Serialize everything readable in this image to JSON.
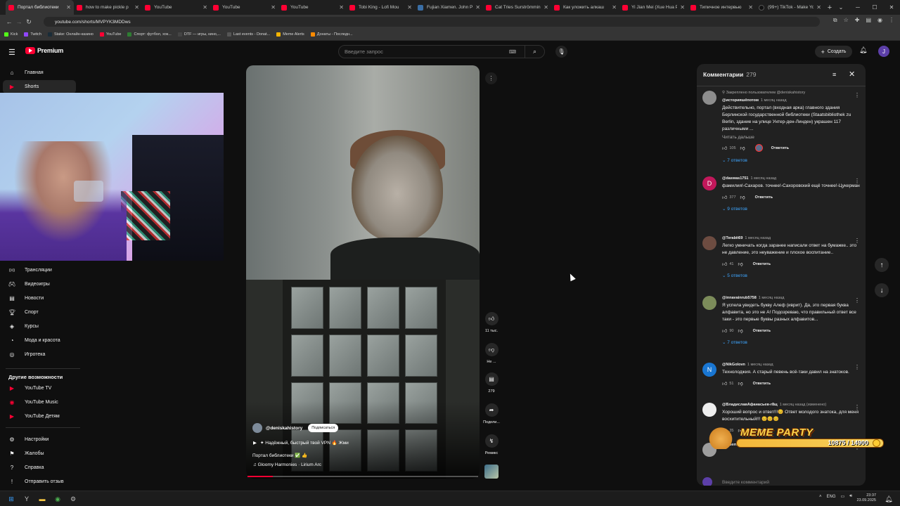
{
  "browser": {
    "tabs": [
      {
        "title": "Портал библиотеки",
        "icon": "youtube",
        "active": true
      },
      {
        "title": "how to make pickle p",
        "icon": "youtube"
      },
      {
        "title": "YouTube",
        "icon": "youtube"
      },
      {
        "title": "YouTube",
        "icon": "youtube"
      },
      {
        "title": "YouTube",
        "icon": "youtube"
      },
      {
        "title": "Tobi King - Lofi Mou",
        "icon": "youtube"
      },
      {
        "title": "Fujian Xiamen. John P",
        "icon": "fujian"
      },
      {
        "title": "Cat Tries Surströmmin",
        "icon": "youtube"
      },
      {
        "title": "Как уложить алкаш",
        "icon": "youtube"
      },
      {
        "title": "Yi Jian Mei (Xue Hua P",
        "icon": "youtube"
      },
      {
        "title": "Типичное интервью",
        "icon": "youtube"
      },
      {
        "title": "(99+) TikTok - Make Yo",
        "icon": "tiktok"
      }
    ],
    "new_tab": "+",
    "url": "youtube.com/shorts/MVPYK3MDDws",
    "bookmarks": [
      {
        "label": "Kick",
        "color": "#53fc18"
      },
      {
        "label": "Twitch",
        "color": "#9146ff"
      },
      {
        "label": "Stake: Онлайн-казино",
        "color": "#1a2c38"
      },
      {
        "label": "YouTube",
        "color": "#ff0033"
      },
      {
        "label": "Спорт: футбол, хок...",
        "color": "#2e7d32"
      },
      {
        "label": "DTF — игры, кино,...",
        "color": "#444444"
      },
      {
        "label": "Last events - Donat...",
        "color": "#555555"
      },
      {
        "label": "Meme Alerts",
        "color": "#f5b400"
      },
      {
        "label": "Донаты - Последн...",
        "color": "#ff8a00"
      }
    ]
  },
  "header": {
    "logo_text": "Premium",
    "search_placeholder": "Введите запрос",
    "create_label": "Создать",
    "avatar_letter": "J"
  },
  "sidebar": {
    "top_items": [
      {
        "label": "Главная",
        "icon": "home-icon"
      },
      {
        "label": "Shorts",
        "icon": "shorts-icon",
        "active": true
      }
    ],
    "explore_items": [
      {
        "label": "Трансляции",
        "icon": "live-icon"
      },
      {
        "label": "Видеоигры",
        "icon": "gamepad-icon"
      },
      {
        "label": "Новости",
        "icon": "news-icon"
      },
      {
        "label": "Спорт",
        "icon": "trophy-icon"
      },
      {
        "label": "Курсы",
        "icon": "courses-icon"
      },
      {
        "label": "Мода и красота",
        "icon": "fashion-icon"
      },
      {
        "label": "Игротека",
        "icon": "playables-icon"
      }
    ],
    "more_heading": "Другие возможности",
    "more_items": [
      {
        "label": "YouTube TV",
        "icon": "youtube-tv-icon"
      },
      {
        "label": "YouTube Music",
        "icon": "youtube-music-icon"
      },
      {
        "label": "YouTube Детям",
        "icon": "youtube-kids-icon"
      }
    ],
    "bottom_items": [
      {
        "label": "Настройки",
        "icon": "settings-icon"
      },
      {
        "label": "Жалобы",
        "icon": "flag-icon"
      },
      {
        "label": "Справка",
        "icon": "help-icon"
      },
      {
        "label": "Отправить отзыв",
        "icon": "feedback-icon"
      }
    ]
  },
  "video": {
    "channel": "@deniskahistory",
    "subscribe_label": "Подписаться",
    "promo_line": "✦ Надёжный, быстрый твой VPN 🔥 Жми",
    "title": "Портал библиотеки ✅ 👍",
    "music": "♫ Gloomy Harmonies · Lirium Arc",
    "progress": 0.11,
    "actions": {
      "likes": "11 тыс.",
      "dislike": "Не ...",
      "comments": "279",
      "share": "Подели...",
      "remix": "Ремикс"
    }
  },
  "comments": {
    "title": "Комментарии",
    "count": "279",
    "items": [
      {
        "pinned": "Закреплено пользователем @deniskahistory",
        "author": "@историяшёпотом",
        "time": "1 месяц назад",
        "text": "Действительно, портал (входная арка) главного здания Берлинской государственной библиотеки (Staatsbibliothek zu Berlin, здание на улице Унтер-ден-Линден) украшен 117 различными ...",
        "more": "Читать дальше",
        "likes": "105",
        "reply_label": "Ответить",
        "replies": "7 ответов",
        "avatar_letter": "",
        "avatar_color": "#8d8d8d"
      },
      {
        "author": "@daswas1751",
        "time": "1 месяц назад",
        "text": "фамилия!-Сахаров. точнее!-Сахоровский ещё точнее!-Цукерман",
        "likes": "377",
        "reply_label": "Ответить",
        "replies": "9 ответов",
        "avatar_letter": "D",
        "avatar_color": "#c2185b"
      },
      {
        "author": "@Terabit69",
        "time": "1 месяц назад",
        "text": "Легко умничать когда заранее написали ответ на бумажке.. это не давление, это неуважение и плохое воспитание..",
        "likes": "41",
        "reply_label": "Ответить",
        "replies": "5 ответов",
        "avatar_letter": "",
        "avatar_color": "#6d4c41"
      },
      {
        "author": "@innavainrub5758",
        "time": "1 месяц назад",
        "text": "Я успела увидеть букву Алеф (иврит). Да, это первая буква алфавита, но это не А! Подозреваю, что правильный ответ все таки - это первые буквы разных алфавитов...",
        "likes": "90",
        "reply_label": "Ответить",
        "replies": "7 ответов",
        "avatar_letter": "",
        "avatar_color": "#7c8c5a"
      },
      {
        "author": "@NikGolovn",
        "time": "1 месяц назад",
        "text": "Технолоджия. А старый певень всё-таки давил на знатоков.",
        "likes": "51",
        "reply_label": "Ответить",
        "avatar_letter": "N",
        "avatar_color": "#1976d2"
      },
      {
        "author": "@ВладиславАфанасьев-г8щ",
        "time": "1 месяц назад (изменено)",
        "text": "Хороший вопрос и ответ!!!😊 Ответ молодого знатока, для меня восхитительный!!! 😊😊😊",
        "likes": "35",
        "reply_label": "Ответить",
        "avatar_letter": "",
        "avatar_color": "#eeeeee"
      },
      {
        "author": "@nisemenov",
        "time": "1 месяц назад",
        "text": "",
        "avatar_letter": "",
        "avatar_color": "#9e9e9e"
      }
    ],
    "input_placeholder": "Введите комментарий"
  },
  "overlay": {
    "title": "MEME PARTY",
    "progress": "10875 / 14900",
    "progress_fraction": 0.73
  },
  "taskbar": {
    "lang": "ENG",
    "time": "23:37",
    "date": "23.09.2025"
  }
}
